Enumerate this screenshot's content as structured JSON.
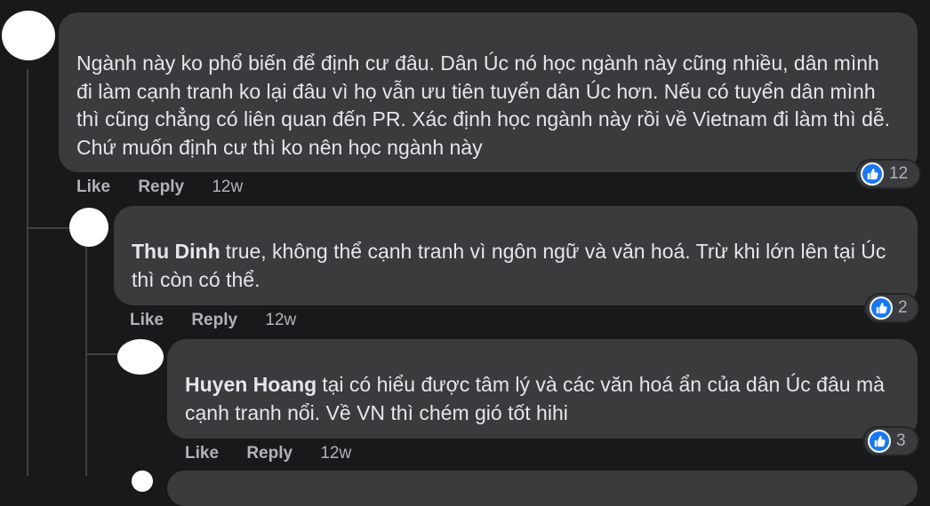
{
  "comments": [
    {
      "author": "",
      "text": "Ngành này ko phổ biến để định cư đâu. Dân Úc nó học ngành này cũng nhiều, dân mình đi làm cạnh tranh ko lại đâu vì họ vẫn ưu tiên tuyển dân Úc hơn. Nếu có tuyển dân mình thì cũng chẳng có liên quan đến PR. Xác định học ngành này rồi về Vietnam đi làm thì dễ. Chứ muốn định cư thì ko nên học ngành này",
      "like_label": "Like",
      "reply_label": "Reply",
      "time": "12w",
      "reactions": "12"
    },
    {
      "author": "Thu Dinh",
      "text": "true, không thể cạnh tranh vì ngôn ngữ và văn hoá. Trừ khi lớn lên tại Úc thì còn có thể.",
      "like_label": "Like",
      "reply_label": "Reply",
      "time": "12w",
      "reactions": "2"
    },
    {
      "author": "Huyen Hoang",
      "text": "tại có hiểu được tâm lý và các văn hoá ẩn của dân Úc đâu mà cạnh tranh nổi. Về VN thì chém gió tốt hihi",
      "like_label": "Like",
      "reply_label": "Reply",
      "time": "12w",
      "reactions": "3"
    }
  ],
  "colors": {
    "background": "#18191a",
    "bubble": "#3a3b3c",
    "text": "#e4e6eb",
    "secondary_text": "#b0b3b8",
    "like_blue": "#1877f2"
  }
}
